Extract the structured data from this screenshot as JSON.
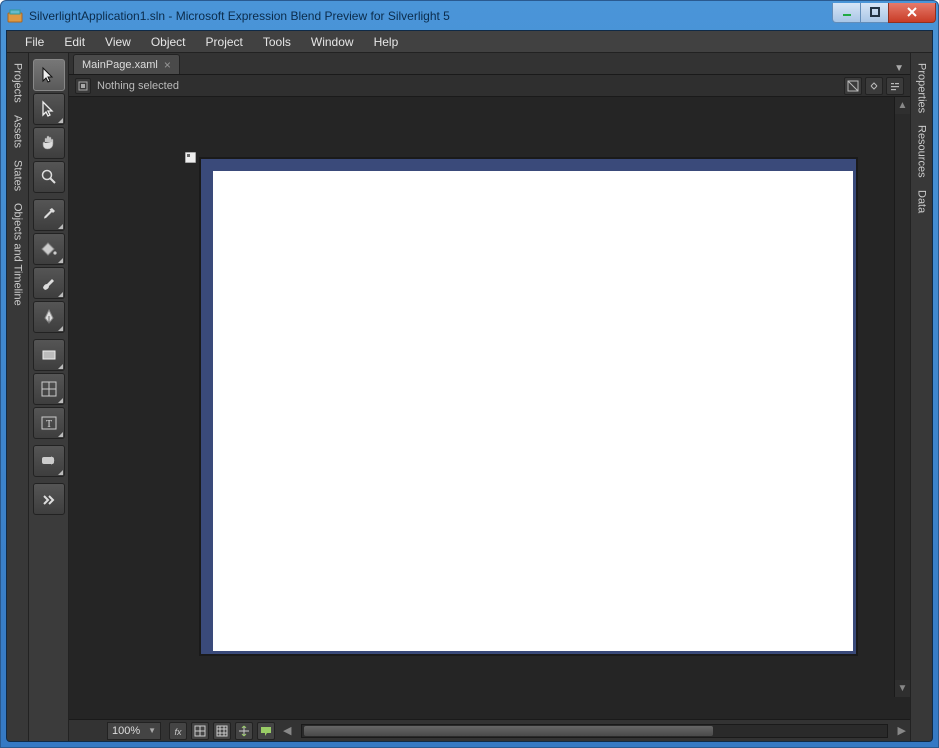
{
  "window": {
    "title": "SilverlightApplication1.sln - Microsoft Expression Blend Preview for Silverlight 5"
  },
  "menu": {
    "items": [
      "File",
      "Edit",
      "View",
      "Object",
      "Project",
      "Tools",
      "Window",
      "Help"
    ]
  },
  "left_panels": [
    "Projects",
    "Assets",
    "States",
    "Objects and Timeline"
  ],
  "right_panels": [
    "Properties",
    "Resources",
    "Data"
  ],
  "document": {
    "tab_label": "MainPage.xaml",
    "selection_text": "Nothing selected"
  },
  "tools": [
    {
      "id": "selection",
      "icon": "cursor",
      "selected": true,
      "flyout": false
    },
    {
      "id": "direct-selection",
      "icon": "cursor-outline",
      "selected": false,
      "flyout": true
    },
    {
      "id": "pan",
      "icon": "hand",
      "selected": false,
      "flyout": false
    },
    {
      "id": "zoom",
      "icon": "magnifier",
      "selected": false,
      "flyout": false
    },
    {
      "id": "eyedropper",
      "icon": "eyedropper",
      "selected": false,
      "flyout": true
    },
    {
      "id": "paint-bucket",
      "icon": "bucket",
      "selected": false,
      "flyout": true
    },
    {
      "id": "brush",
      "icon": "brush",
      "selected": false,
      "flyout": true
    },
    {
      "id": "pen",
      "icon": "pen",
      "selected": false,
      "flyout": true
    },
    {
      "id": "rectangle",
      "icon": "rect",
      "selected": false,
      "flyout": true
    },
    {
      "id": "layout-panel",
      "icon": "grid",
      "selected": false,
      "flyout": true
    },
    {
      "id": "text",
      "icon": "text",
      "selected": false,
      "flyout": true
    },
    {
      "id": "common-controls",
      "icon": "button",
      "selected": false,
      "flyout": true
    },
    {
      "id": "asset-tools",
      "icon": "chevrons",
      "selected": false,
      "flyout": false
    }
  ],
  "status": {
    "zoom": "100%"
  }
}
